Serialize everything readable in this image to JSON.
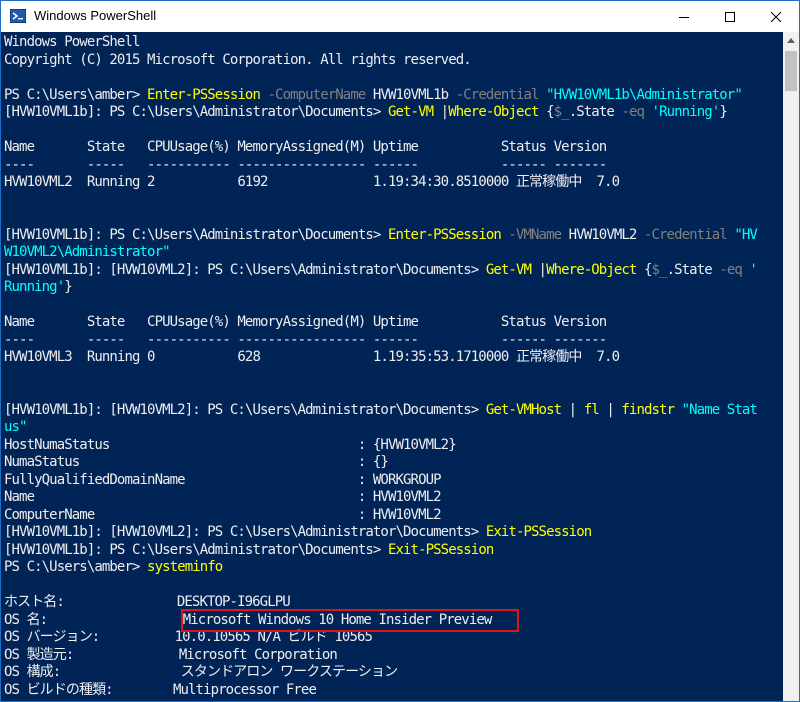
{
  "window": {
    "title": "Windows PowerShell"
  },
  "console": {
    "lines": [
      [
        {
          "t": "Windows PowerShell",
          "c": ""
        }
      ],
      [
        {
          "t": "Copyright (C) 2015 Microsoft Corporation. All rights reserved.",
          "c": ""
        }
      ],
      [
        {
          "t": "",
          "c": ""
        }
      ],
      [
        {
          "t": "PS C:\\Users\\amber> ",
          "c": ""
        },
        {
          "t": "Enter-PSSession",
          "c": "cmd"
        },
        {
          "t": " -ComputerName",
          "c": "param"
        },
        {
          "t": " HVW10VML1b",
          "c": ""
        },
        {
          "t": " -Credential",
          "c": "param"
        },
        {
          "t": " \"HVW10VML1b\\Administrator\"",
          "c": "str"
        }
      ],
      [
        {
          "t": "[HVW10VML1b]: PS C:\\Users\\Administrator\\Documents> ",
          "c": ""
        },
        {
          "t": "Get-VM",
          "c": "cmd"
        },
        {
          "t": " |",
          "c": ""
        },
        {
          "t": "Where-Object",
          "c": "cmd"
        },
        {
          "t": " {",
          "c": ""
        },
        {
          "t": "$_",
          "c": "param"
        },
        {
          "t": ".State",
          "c": ""
        },
        {
          "t": " -eq",
          "c": "param"
        },
        {
          "t": " 'Running'",
          "c": "str"
        },
        {
          "t": "}",
          "c": ""
        }
      ],
      [
        {
          "t": "",
          "c": ""
        }
      ],
      [
        {
          "t": "Name       State   CPUUsage(%) MemoryAssigned(M) Uptime           Status Version",
          "c": ""
        }
      ],
      [
        {
          "t": "----       -----   ----------- ----------------- ------           ------ -------",
          "c": ""
        }
      ],
      [
        {
          "t": "HVW10VML2  Running 2           6192              1.19:34:30.8510000 正常稼働中  7.0",
          "c": ""
        }
      ],
      [
        {
          "t": "",
          "c": ""
        }
      ],
      [
        {
          "t": "",
          "c": ""
        }
      ],
      [
        {
          "t": "[HVW10VML1b]: PS C:\\Users\\Administrator\\Documents> ",
          "c": ""
        },
        {
          "t": "Enter-PSSession",
          "c": "cmd"
        },
        {
          "t": " -VMName",
          "c": "param"
        },
        {
          "t": " HVW10VML2",
          "c": ""
        },
        {
          "t": " -Credential",
          "c": "param"
        },
        {
          "t": " \"HV",
          "c": "str"
        }
      ],
      [
        {
          "t": "W10VML2\\Administrator\"",
          "c": "str"
        }
      ],
      [
        {
          "t": "[HVW10VML1b]: [HVW10VML2]: PS C:\\Users\\Administrator\\Documents> ",
          "c": ""
        },
        {
          "t": "Get-VM",
          "c": "cmd"
        },
        {
          "t": " |",
          "c": ""
        },
        {
          "t": "Where-Object",
          "c": "cmd"
        },
        {
          "t": " {",
          "c": ""
        },
        {
          "t": "$_",
          "c": "param"
        },
        {
          "t": ".State",
          "c": ""
        },
        {
          "t": " -eq",
          "c": "param"
        },
        {
          "t": " '",
          "c": "str"
        }
      ],
      [
        {
          "t": "Running'",
          "c": "str"
        },
        {
          "t": "}",
          "c": ""
        }
      ],
      [
        {
          "t": "",
          "c": ""
        }
      ],
      [
        {
          "t": "Name       State   CPUUsage(%) MemoryAssigned(M) Uptime           Status Version",
          "c": ""
        }
      ],
      [
        {
          "t": "----       -----   ----------- ----------------- ------           ------ -------",
          "c": ""
        }
      ],
      [
        {
          "t": "HVW10VML3  Running 0           628               1.19:35:53.1710000 正常稼働中  7.0",
          "c": ""
        }
      ],
      [
        {
          "t": "",
          "c": ""
        }
      ],
      [
        {
          "t": "",
          "c": ""
        }
      ],
      [
        {
          "t": "[HVW10VML1b]: [HVW10VML2]: PS C:\\Users\\Administrator\\Documents> ",
          "c": ""
        },
        {
          "t": "Get-VMHost",
          "c": "cmd"
        },
        {
          "t": " | ",
          "c": ""
        },
        {
          "t": "fl",
          "c": "cmd"
        },
        {
          "t": " | ",
          "c": ""
        },
        {
          "t": "findstr",
          "c": "cmd"
        },
        {
          "t": " \"Name Stat",
          "c": "str"
        }
      ],
      [
        {
          "t": "us\"",
          "c": "str"
        }
      ],
      [
        {
          "t": "HostNumaStatus                                 : {HVW10VML2}",
          "c": ""
        }
      ],
      [
        {
          "t": "NumaStatus                                     : {}",
          "c": ""
        }
      ],
      [
        {
          "t": "FullyQualifiedDomainName                       : WORKGROUP",
          "c": ""
        }
      ],
      [
        {
          "t": "Name                                           : HVW10VML2",
          "c": ""
        }
      ],
      [
        {
          "t": "ComputerName                                   : HVW10VML2",
          "c": ""
        }
      ],
      [
        {
          "t": "[HVW10VML1b]: [HVW10VML2]: PS C:\\Users\\Administrator\\Documents> ",
          "c": ""
        },
        {
          "t": "Exit-PSSession",
          "c": "cmd"
        }
      ],
      [
        {
          "t": "[HVW10VML1b]: PS C:\\Users\\Administrator\\Documents> ",
          "c": ""
        },
        {
          "t": "Exit-PSSession",
          "c": "cmd"
        }
      ],
      [
        {
          "t": "PS C:\\Users\\amber> ",
          "c": ""
        },
        {
          "t": "systeminfo",
          "c": "cmd"
        }
      ],
      [
        {
          "t": "",
          "c": ""
        }
      ],
      [
        {
          "t": "ホスト名:               DESKTOP-I96GLPU",
          "c": ""
        }
      ],
      [
        {
          "t": "OS 名:                  Microsoft Windows 10 Home Insider Preview",
          "c": ""
        }
      ],
      [
        {
          "t": "OS バージョン:          10.0.10565 N/A ビルド 10565",
          "c": ""
        }
      ],
      [
        {
          "t": "OS 製造元:              Microsoft Corporation",
          "c": ""
        }
      ],
      [
        {
          "t": "OS 構成:                スタンドアロン ワークステーション",
          "c": ""
        }
      ],
      [
        {
          "t": "OS ビルドの種類:        Multiprocessor Free",
          "c": ""
        }
      ]
    ]
  },
  "colors": {
    "console_bg": "#012456",
    "console_text": "#eeedf0",
    "command": "#ffff00",
    "parameter": "#808080",
    "string": "#00ffff",
    "highlight_box": "#e0141e",
    "window_border": "#1e6fc4"
  },
  "icons": {
    "app": "powershell-icon",
    "minimize": "minimize-icon",
    "maximize": "maximize-icon",
    "close": "close-icon",
    "scroll_up": "scroll-up-arrow-icon"
  },
  "highlight": {
    "target_line": "OS 名"
  }
}
